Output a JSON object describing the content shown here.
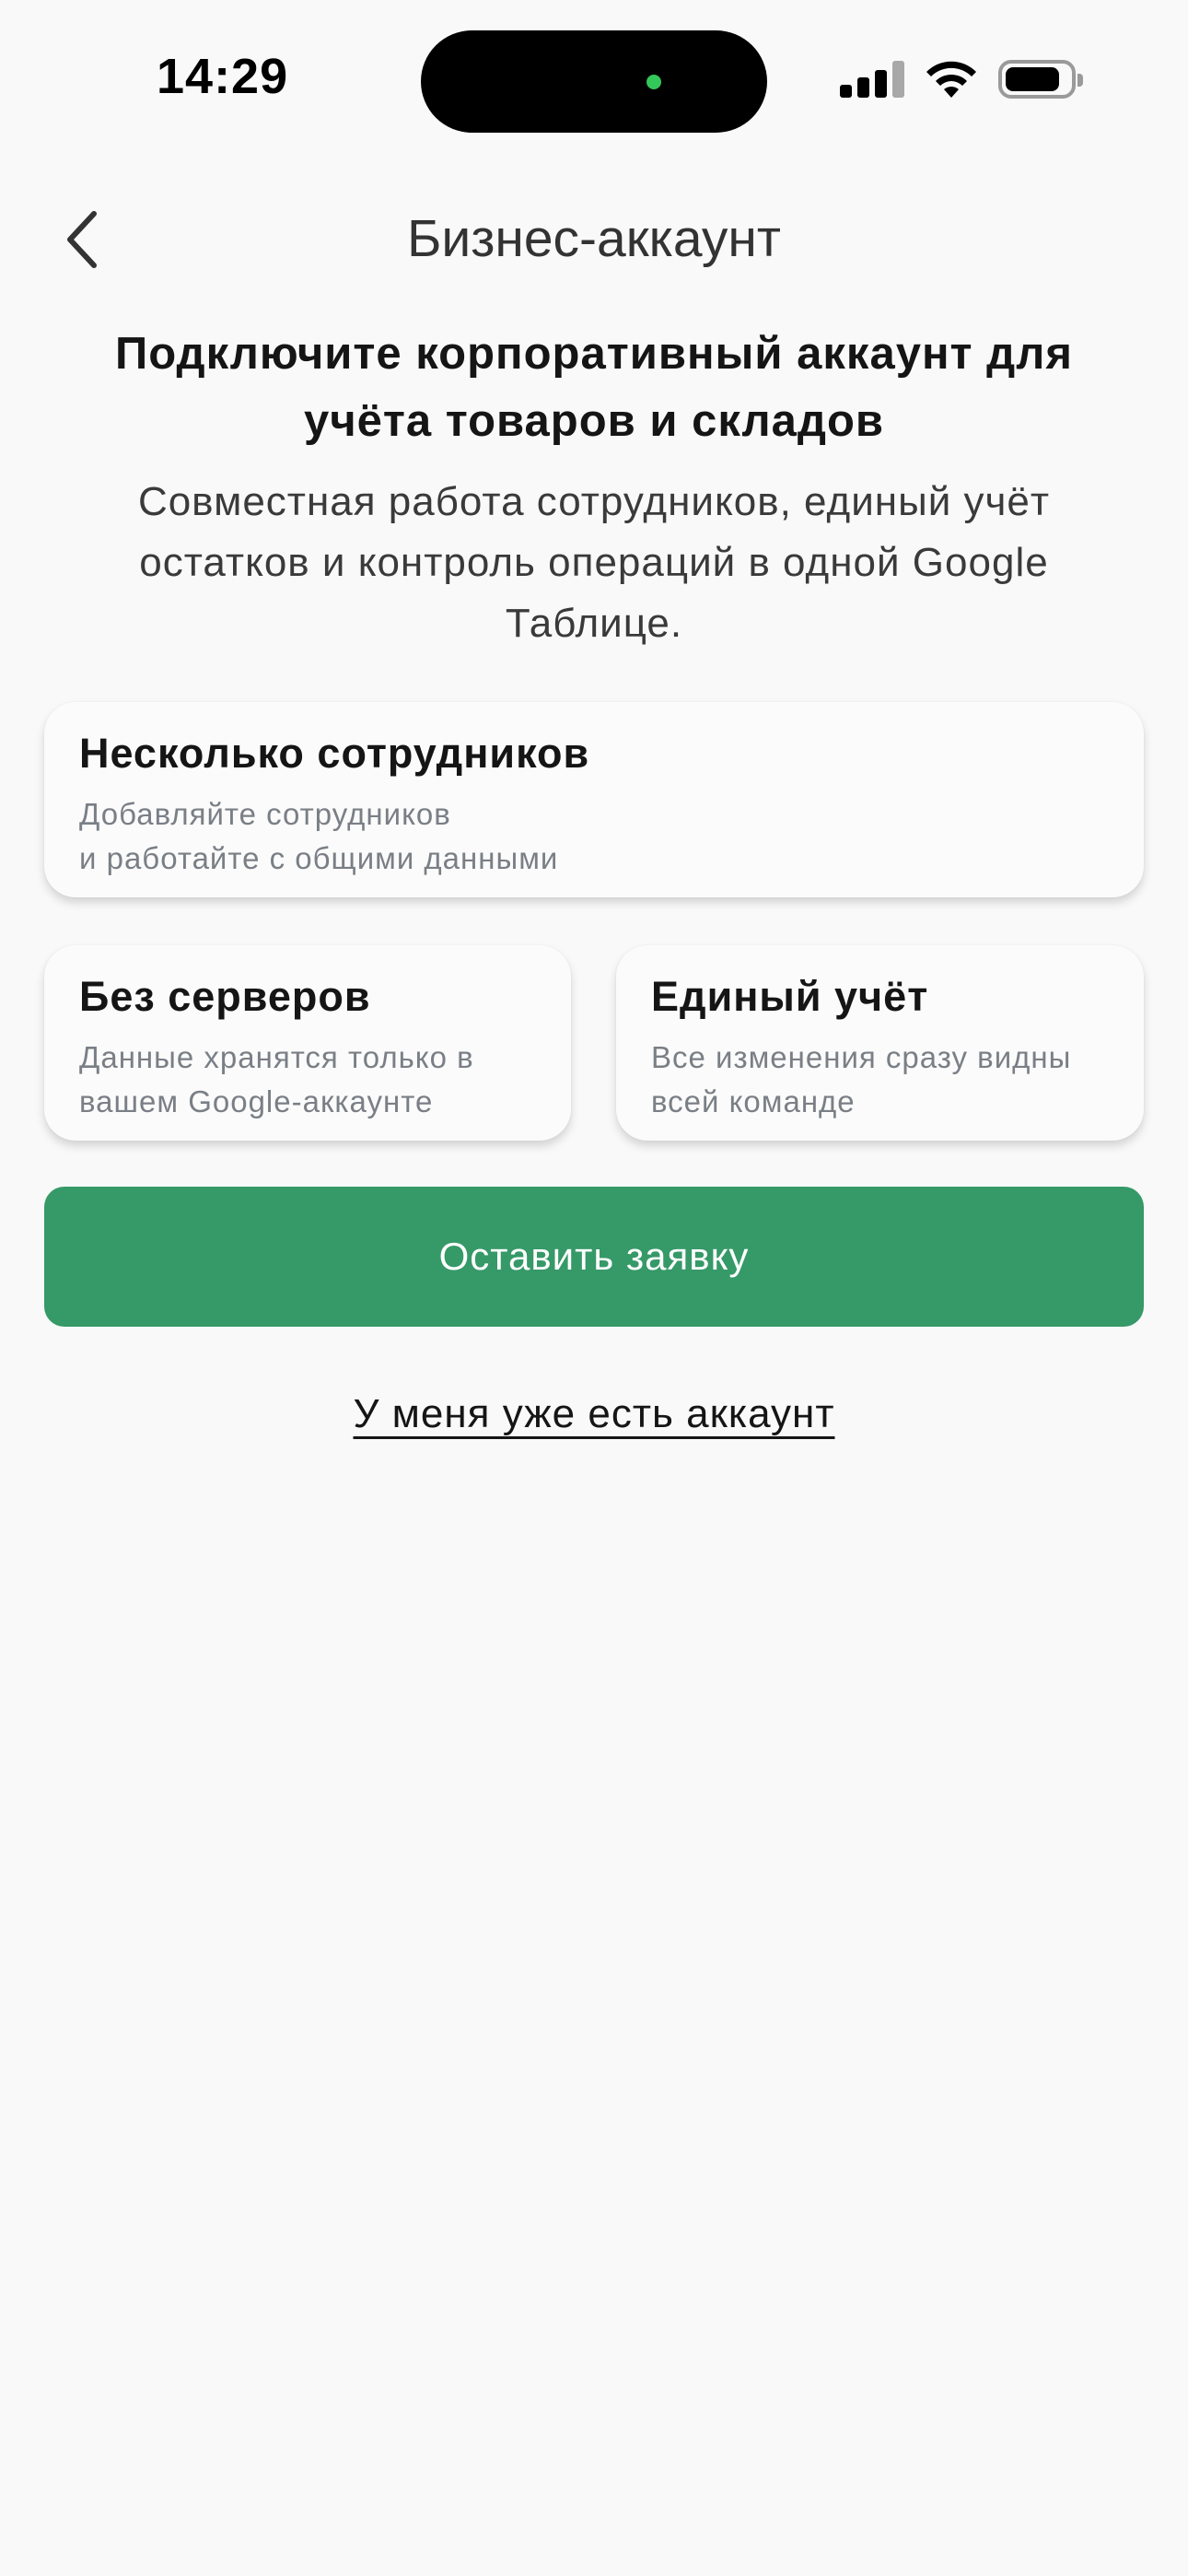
{
  "status_bar": {
    "time": "14:29",
    "icons": [
      "signal-icon",
      "wifi-icon",
      "battery-icon"
    ],
    "battery_level": 0.8,
    "island_indicator_color": "#34c759"
  },
  "header": {
    "back_icon": "chevron-left-icon",
    "title": "Бизнес-аккаунт"
  },
  "intro": {
    "headline": "Подключите корпоративный аккаунт для учёта товаров и складов",
    "subtitle": "Совместная работа сотрудников, единый учёт остатков и контроль операций в одной Google Таблице."
  },
  "features": [
    {
      "title": "Несколько сотрудников",
      "text": "Добавляйте сотрудников\nи работайте с общими данными"
    },
    {
      "title": "Без серверов",
      "text": "Данные хранятся только в\nвашем Google-аккаунте"
    },
    {
      "title": "Единый учёт",
      "text": "Все изменения сразу видны\nвсей команде"
    }
  ],
  "actions": {
    "submit_label": "Оставить заявку",
    "existing_account_label": "У меня уже есть аккаунт"
  },
  "colors": {
    "accent": "#369968",
    "background": "#f9f9f9",
    "secondary_text": "#7a7f86"
  }
}
